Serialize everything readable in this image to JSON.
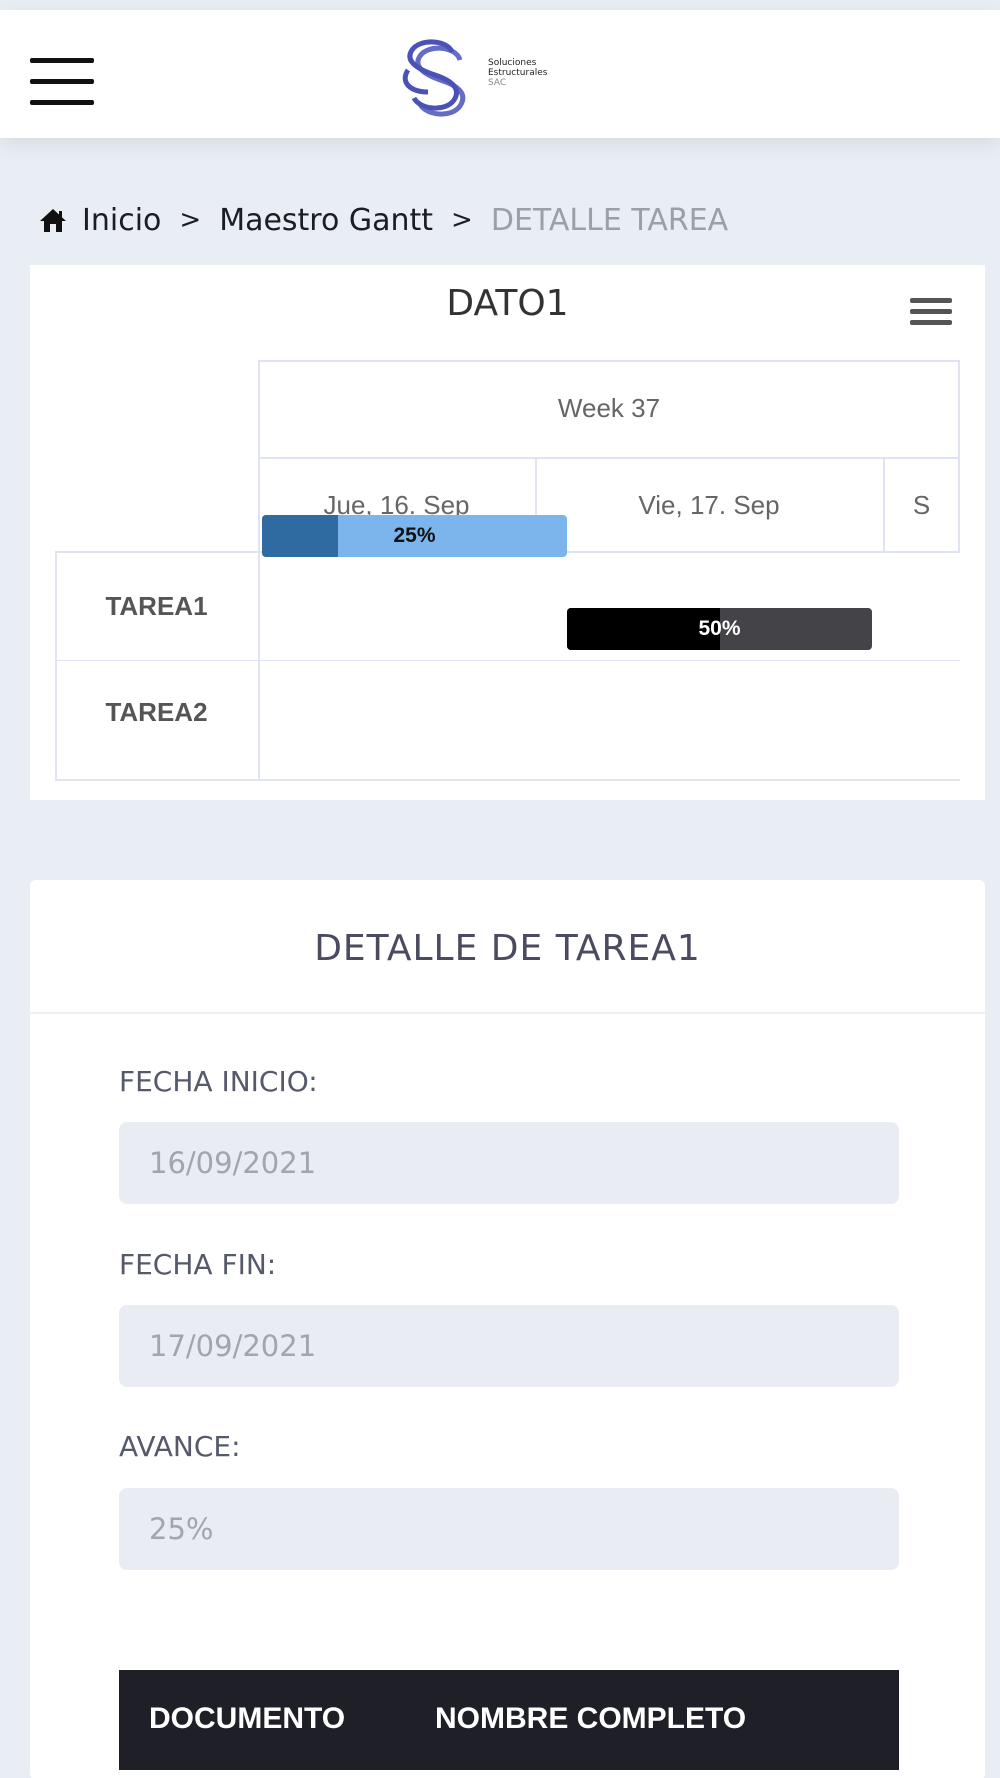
{
  "header": {
    "logo_lines": [
      "Soluciones",
      "Estructurales",
      "SAC"
    ]
  },
  "breadcrumb": {
    "home": "Inicio",
    "sep1": ">",
    "parent": "Maestro Gantt",
    "sep2": ">",
    "current": "DETALLE TAREA"
  },
  "chart": {
    "title": "DATO1",
    "week_label": "Week 37",
    "days": [
      "Jue, 16. Sep",
      "Vie, 17. Sep",
      "S"
    ]
  },
  "chart_data": {
    "type": "gantt",
    "title": "DATO1",
    "tasks": [
      {
        "name": "TAREA1",
        "start": "2021-09-16",
        "end": "2021-09-17",
        "progress": 0.25,
        "label": "25%",
        "color": "#7cb5ec",
        "progress_color": "#2f6aa0"
      },
      {
        "name": "TAREA2",
        "start": "2021-09-17",
        "end": "2021-09-18",
        "progress": 0.5,
        "label": "50%",
        "color": "#434348",
        "progress_color": "#000000"
      }
    ]
  },
  "detail": {
    "title": "DETALLE DE TAREA1",
    "fecha_inicio_label": "FECHA INICIO:",
    "fecha_inicio_value": "16/09/2021",
    "fecha_fin_label": "FECHA FIN:",
    "fecha_fin_value": "17/09/2021",
    "avance_label": "AVANCE:",
    "avance_value": "25%",
    "table_headers": [
      "DOCUMENTO",
      "NOMBRE COMPLETO"
    ]
  },
  "colors": {
    "background": "#e9edf4",
    "table_header": "#1f2027",
    "input_bg": "#e9edf3"
  }
}
